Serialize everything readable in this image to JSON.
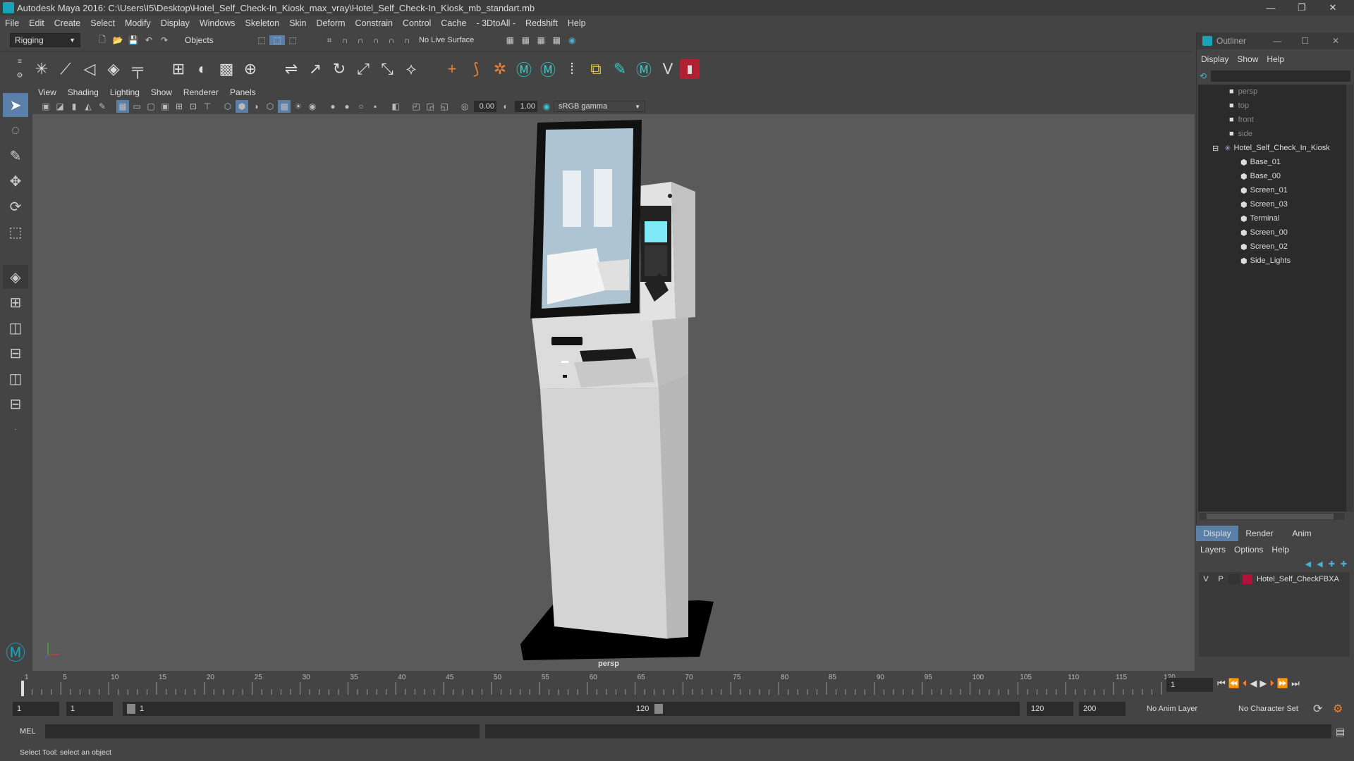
{
  "window": {
    "title": "Autodesk Maya 2016: C:\\Users\\I5\\Desktop\\Hotel_Self_Check-In_Kiosk_max_vray\\Hotel_Self_Check-In_Kiosk_mb_standart.mb",
    "minimize": "—",
    "maximize": "❐",
    "close": "✕"
  },
  "menubar": [
    "File",
    "Edit",
    "Create",
    "Select",
    "Modify",
    "Display",
    "Windows",
    "Skeleton",
    "Skin",
    "Deform",
    "Constrain",
    "Control",
    "Cache",
    "- 3DtoAll -",
    "Redshift",
    "Help"
  ],
  "statusline": {
    "menuset": "Rigging",
    "selection_mode": "Objects",
    "live_surface": "No Live Surface"
  },
  "panel": {
    "menus": [
      "View",
      "Shading",
      "Lighting",
      "Show",
      "Renderer",
      "Panels"
    ],
    "exposure": "0.00",
    "gamma": "1.00",
    "colorspace": "sRGB gamma",
    "camera_label": "persp"
  },
  "timeline": {
    "ticks": [
      "1",
      "5",
      "10",
      "15",
      "20",
      "25",
      "30",
      "35",
      "40",
      "45",
      "50",
      "55",
      "60",
      "65",
      "70",
      "75",
      "80",
      "85",
      "90",
      "95",
      "100",
      "105",
      "110",
      "115",
      "120"
    ],
    "current_frame": "1"
  },
  "range": {
    "start": "1",
    "current": "1",
    "slider_start": "1",
    "slider_end": "120",
    "end": "120",
    "max": "200",
    "anim_layer": "No Anim Layer",
    "character_set": "No Character Set"
  },
  "cmdline": {
    "mode": "MEL"
  },
  "helpline": {
    "text": "Select Tool: select an object"
  },
  "outliner": {
    "title": "Outliner",
    "menus": [
      "Display",
      "Show",
      "Help"
    ],
    "cameras": [
      "persp",
      "top",
      "front",
      "side"
    ],
    "group": "Hotel_Self_Check_In_Kiosk",
    "children": [
      "Base_01",
      "Base_00",
      "Screen_01",
      "Screen_03",
      "Terminal",
      "Screen_00",
      "Screen_02",
      "Side_Lights"
    ]
  },
  "layers": {
    "tabs": [
      "Display",
      "Render",
      "Anim"
    ],
    "menus": [
      "Layers",
      "Options",
      "Help"
    ],
    "layer_v": "V",
    "layer_p": "P",
    "layer_name": "Hotel_Self_CheckFBXA",
    "layer_color": "#b0123a"
  }
}
